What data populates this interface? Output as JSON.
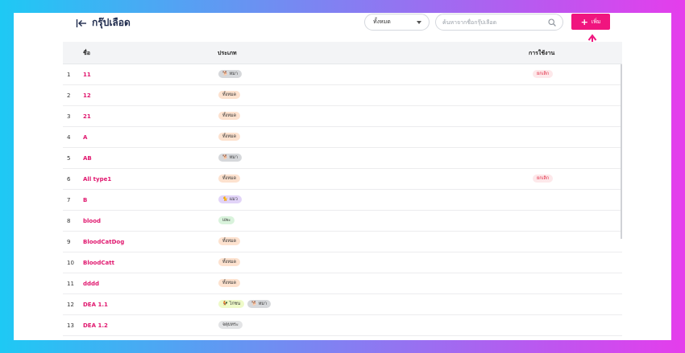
{
  "header": {
    "title": "กรุ๊ปเลือด",
    "back_icon": "arrow-left-bar-icon",
    "filter_value": "ทั้งหมด",
    "search_placeholder": "ค้นหาจากชื่อกรุ๊ปเลือด",
    "add_label": "เพิ่ม"
  },
  "colors": {
    "accent": "#f0157f",
    "name_text": "#e0176e",
    "usage_badge_bg": "#fde8ea",
    "usage_badge_text": "#e0253f"
  },
  "table": {
    "columns": [
      "ชื่อ",
      "ประเภท",
      "การใช้งาน"
    ],
    "rows": [
      {
        "num": "1",
        "name": "11",
        "tags": [
          {
            "label": "🐕 หมา",
            "bg": "#d6d8db"
          }
        ],
        "usage": "ยกเลิก"
      },
      {
        "num": "2",
        "name": "12",
        "tags": [
          {
            "label": "ทั้งหมด",
            "bg": "#fde2cf"
          }
        ],
        "usage": ""
      },
      {
        "num": "3",
        "name": "21",
        "tags": [
          {
            "label": "ทั้งหมด",
            "bg": "#fde2cf"
          }
        ],
        "usage": ""
      },
      {
        "num": "4",
        "name": "A",
        "tags": [
          {
            "label": "ทั้งหมด",
            "bg": "#fde2cf"
          }
        ],
        "usage": ""
      },
      {
        "num": "5",
        "name": "AB",
        "tags": [
          {
            "label": "🐕 หมา",
            "bg": "#d6d8db"
          }
        ],
        "usage": ""
      },
      {
        "num": "6",
        "name": "All type1",
        "tags": [
          {
            "label": "ทั้งหมด",
            "bg": "#fde2cf"
          }
        ],
        "usage": "ยกเลิก"
      },
      {
        "num": "7",
        "name": "B",
        "tags": [
          {
            "label": "🐈 แมว",
            "bg": "#e2d4f8"
          }
        ],
        "usage": ""
      },
      {
        "num": "8",
        "name": "blood",
        "tags": [
          {
            "label": "แพะ",
            "bg": "#d9f3dc"
          }
        ],
        "usage": ""
      },
      {
        "num": "9",
        "name": "BloodCatDog",
        "tags": [
          {
            "label": "ทั้งหมด",
            "bg": "#fde2cf"
          }
        ],
        "usage": ""
      },
      {
        "num": "10",
        "name": "BloodCatt",
        "tags": [
          {
            "label": "ทั้งหมด",
            "bg": "#fde2cf"
          }
        ],
        "usage": ""
      },
      {
        "num": "11",
        "name": "dddd",
        "tags": [
          {
            "label": "ทั้งหมด",
            "bg": "#fde2cf"
          }
        ],
        "usage": ""
      },
      {
        "num": "12",
        "name": "DEA 1.1",
        "tags": [
          {
            "label": "🐓 ไก่ชน",
            "bg": "#eefac8"
          },
          {
            "label": "🐕 หมา",
            "bg": "#d6d8db"
          }
        ],
        "usage": ""
      },
      {
        "num": "13",
        "name": "DEA 1.2",
        "tags": [
          {
            "label": "จตุบทระ",
            "bg": "#e3e4e6"
          }
        ],
        "usage": ""
      }
    ]
  }
}
